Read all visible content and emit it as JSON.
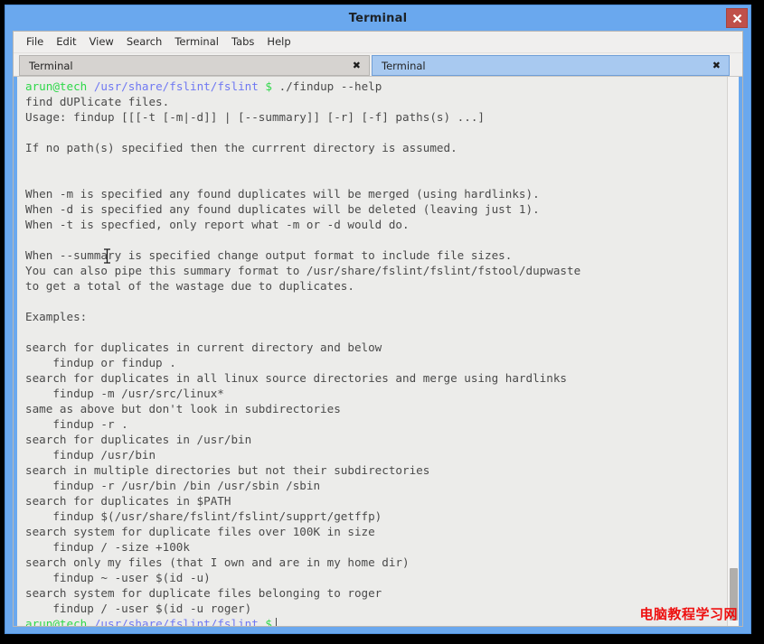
{
  "window": {
    "title": "Terminal",
    "close_label": "✖"
  },
  "menubar": {
    "items": [
      {
        "label": "File"
      },
      {
        "label": "Edit"
      },
      {
        "label": "View"
      },
      {
        "label": "Search"
      },
      {
        "label": "Terminal"
      },
      {
        "label": "Tabs"
      },
      {
        "label": "Help"
      }
    ]
  },
  "tabs": [
    {
      "label": "Terminal",
      "close": "✖",
      "active": false
    },
    {
      "label": "Terminal",
      "close": "✖",
      "active": true
    }
  ],
  "terminal": {
    "prompt": {
      "user_host": "arun@tech",
      "path": "/usr/share/fslint/fslint",
      "symbol": "$"
    },
    "command": "./findup --help",
    "lines": [
      "find dUPlicate files.",
      "Usage: findup [[[-t [-m|-d]] | [--summary]] [-r] [-f] paths(s) ...]",
      "",
      "If no path(s) specified then the currrent directory is assumed.",
      "",
      "",
      "When -m is specified any found duplicates will be merged (using hardlinks).",
      "When -d is specified any found duplicates will be deleted (leaving just 1).",
      "When -t is specfied, only report what -m or -d would do.",
      "",
      "When --summary is specified change output format to include file sizes.",
      "You can also pipe this summary format to /usr/share/fslint/fslint/fstool/dupwaste",
      "to get a total of the wastage due to duplicates.",
      "",
      "Examples:",
      "",
      "search for duplicates in current directory and below",
      "    findup or findup .",
      "search for duplicates in all linux source directories and merge using hardlinks",
      "    findup -m /usr/src/linux*",
      "same as above but don't look in subdirectories",
      "    findup -r .",
      "search for duplicates in /usr/bin",
      "    findup /usr/bin",
      "search in multiple directories but not their subdirectories",
      "    findup -r /usr/bin /bin /usr/sbin /sbin",
      "search for duplicates in $PATH",
      "    findup $(/usr/share/fslint/fslint/supprt/getffp)",
      "search system for duplicate files over 100K in size",
      "    findup / -size +100k",
      "search only my files (that I own and are in my home dir)",
      "    findup ~ -user $(id -u)",
      "search system for duplicate files belonging to roger",
      "    findup / -user $(id -u roger)"
    ]
  },
  "watermark": {
    "text": "电脑教程学习网"
  },
  "colors": {
    "titlebar": "#6aa8ee",
    "close_button": "#c0504a",
    "active_tab": "#a8c9f0",
    "inactive_tab": "#d6d3d0",
    "terminal_bg": "#ececea",
    "prompt_green": "#2fd84a",
    "prompt_blue": "#6f78f2",
    "text": "#4a4a4a",
    "watermark": "#ee1111"
  }
}
